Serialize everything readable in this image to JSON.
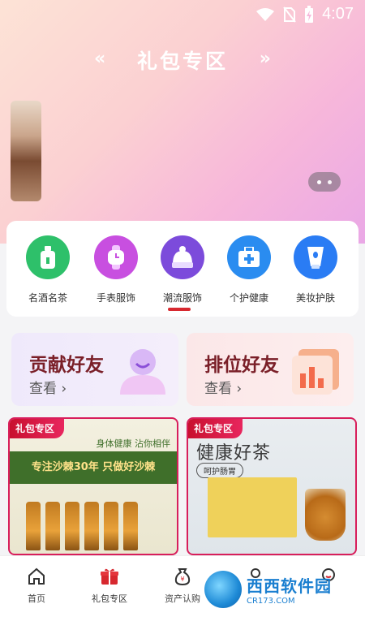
{
  "status_bar": {
    "time": "4:07"
  },
  "header": {
    "title": "礼包专区"
  },
  "banner": {
    "dots": 2,
    "active_dot": 0
  },
  "categories": [
    {
      "label": "名酒名茶",
      "icon": "bottle-icon",
      "color": "#2ec06a"
    },
    {
      "label": "手表服饰",
      "icon": "watch-icon",
      "color": "#c84fe0"
    },
    {
      "label": "潮流服饰",
      "icon": "beanie-icon",
      "color": "#7c4bdb"
    },
    {
      "label": "个护健康",
      "icon": "medkit-icon",
      "color": "#2a8cf0"
    },
    {
      "label": "美妆护肤",
      "icon": "cosmetic-tube-icon",
      "color": "#2a7cf4"
    }
  ],
  "friends": [
    {
      "title": "贡献好友",
      "link": "查看 ›"
    },
    {
      "title": "排位好友",
      "link": "查看 ›"
    }
  ],
  "promos": [
    {
      "tag": "礼包专区",
      "subtitle": "身体健康 沾你相伴",
      "slogan": "专注沙棘30年 只做好沙棘"
    },
    {
      "tag": "礼包专区",
      "headline": "健康好茶",
      "badge": "呵护肠胃"
    }
  ],
  "tabbar": [
    {
      "label": "首页",
      "icon": "home-icon"
    },
    {
      "label": "礼包专区",
      "icon": "gift-icon"
    },
    {
      "label": "资产认购",
      "icon": "money-bag-icon"
    },
    {
      "label": "",
      "icon": "user-icon"
    },
    {
      "label": "",
      "icon": "profile-icon"
    }
  ],
  "watermark": {
    "main": "西西软件园",
    "url": "CR173.COM"
  },
  "colors": {
    "accent": "#d7282f",
    "tag": "#d81e5b"
  }
}
